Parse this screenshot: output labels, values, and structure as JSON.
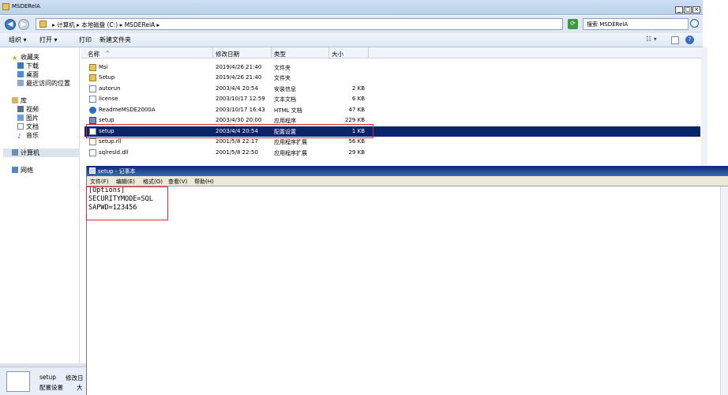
{
  "explorer": {
    "title": "MSDERelA",
    "address_crumbs": "▸ 计算机 ▸ 本地磁盘 (C:) ▸ MSDERelA ▸",
    "search_placeholder": "搜索 MSDERelA",
    "toolbar": {
      "organize": "组织 ▾",
      "open": "打开 ▾",
      "print": "打印",
      "new_folder": "新建文件夹"
    },
    "nav": {
      "favorites": "收藏夹",
      "downloads": "下载",
      "desktop": "桌面",
      "recent": "最近访问的位置",
      "libraries": "库",
      "videos": "视频",
      "pictures": "图片",
      "documents": "文档",
      "music": "音乐",
      "computer": "计算机",
      "network": "网络"
    },
    "columns": {
      "name": "名称",
      "date": "修改日期",
      "type": "类型",
      "size": "大小"
    },
    "files": [
      {
        "name": "Msi",
        "date": "2019/4/26 21:40",
        "type": "文件夹",
        "size": "",
        "icon": "folder-icon"
      },
      {
        "name": "Setup",
        "date": "2019/4/26 21:40",
        "type": "文件夹",
        "size": "",
        "icon": "folder-icon"
      },
      {
        "name": "autorun",
        "date": "2003/4/4 20:54",
        "type": "安装信息",
        "size": "2 KB",
        "icon": "setup-info-icon"
      },
      {
        "name": "license",
        "date": "2003/10/17 12:59",
        "type": "文本文档",
        "size": "6 KB",
        "icon": "text-file-icon"
      },
      {
        "name": "ReadmeMSDE2000A",
        "date": "2003/10/17 16:43",
        "type": "HTML 文档",
        "size": "47 KB",
        "icon": "html-file-icon"
      },
      {
        "name": "setup",
        "date": "2003/4/30 20:00",
        "type": "应用程序",
        "size": "229 KB",
        "icon": "app-icon"
      },
      {
        "name": "setup",
        "date": "2003/4/4 20:54",
        "type": "配置设置",
        "size": "1 KB",
        "icon": "config-file-icon"
      },
      {
        "name": "setup.rll",
        "date": "2001/5/8 22:17",
        "type": "应用程序扩展",
        "size": "56 KB",
        "icon": "dll-file-icon"
      },
      {
        "name": "sqlresld.dll",
        "date": "2001/5/8 22:50",
        "type": "应用程序扩展",
        "size": "29 KB",
        "icon": "dll-file-icon"
      }
    ],
    "details": {
      "name": "setup",
      "modified_label": "修改日",
      "type": "配置设置",
      "size_label": "大"
    }
  },
  "notepad": {
    "title": "setup - 记事本",
    "menu": [
      "文件(F)",
      "编辑(E)",
      "格式(O)",
      "查看(V)",
      "帮助(H)"
    ],
    "lines": [
      "[Options]",
      "SECURITYMODE=SQL",
      "SAPWD=123456"
    ]
  },
  "colors": {
    "selection": "#0a246a",
    "highlight_box": "#e0272f"
  }
}
